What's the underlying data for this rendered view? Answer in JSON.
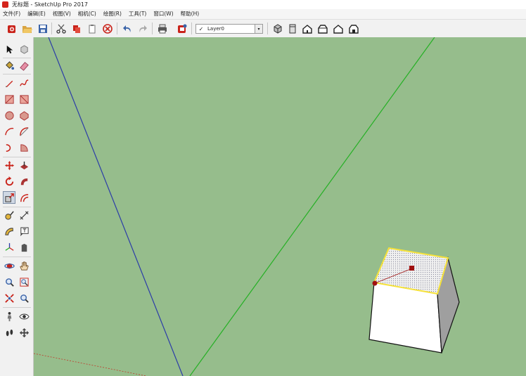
{
  "window": {
    "title": "无标题 - SketchUp Pro 2017"
  },
  "menu": {
    "items": [
      "文件(F)",
      "编辑(E)",
      "视图(V)",
      "相机(C)",
      "绘图(R)",
      "工具(T)",
      "窗口(W)",
      "帮助(H)"
    ]
  },
  "toolbar": {
    "layer": {
      "check": "✓",
      "selected": "Layer0",
      "arrow": "▾"
    }
  },
  "colors": {
    "viewport_bg": "#96bd8c",
    "red_axis": "#c0392b",
    "green_axis": "#24b024",
    "blue_axis": "#2b3ca8",
    "face_selected": "#e8e8e8",
    "selection_highlight": "#f6e23a",
    "inference_point": "#a01010"
  }
}
